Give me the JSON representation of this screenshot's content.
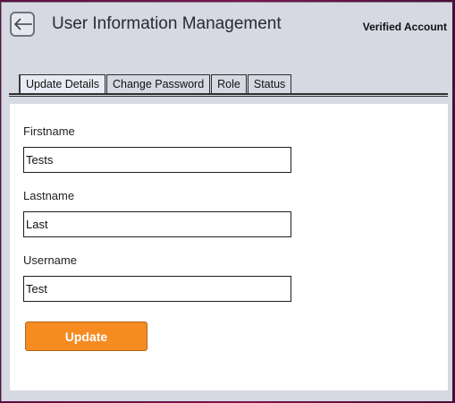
{
  "header": {
    "title": "User Information Management",
    "badge": "Verified Account",
    "back_icon": "arrow-left-icon"
  },
  "tabs": [
    {
      "label": "Update Details",
      "active": true
    },
    {
      "label": "Change Password",
      "active": false
    },
    {
      "label": "Role",
      "active": false
    },
    {
      "label": "Status",
      "active": false
    }
  ],
  "form": {
    "firstname": {
      "label": "Firstname",
      "value": "Tests"
    },
    "lastname": {
      "label": "Lastname",
      "value": "Last"
    },
    "username": {
      "label": "Username",
      "value": "Test"
    },
    "update_label": "Update"
  },
  "colors": {
    "accent": "#f68b22",
    "window_bg": "#d6d9e2",
    "outer_bg": "#6a1249"
  }
}
